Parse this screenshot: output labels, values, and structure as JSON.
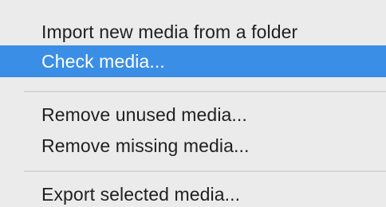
{
  "menu": {
    "items": [
      {
        "label": "Import new media from a folder",
        "highlighted": false
      },
      {
        "label": "Check media...",
        "highlighted": true
      },
      {
        "label": "Remove unused media...",
        "highlighted": false
      },
      {
        "label": "Remove missing media...",
        "highlighted": false
      },
      {
        "label": "Export selected media...",
        "highlighted": false
      }
    ],
    "colors": {
      "background": "#ebebeb",
      "highlight": "#3a8ee6",
      "highlight_text": "#ffffff",
      "text": "#1f1f1f",
      "separator": "#d6d6d6"
    }
  }
}
